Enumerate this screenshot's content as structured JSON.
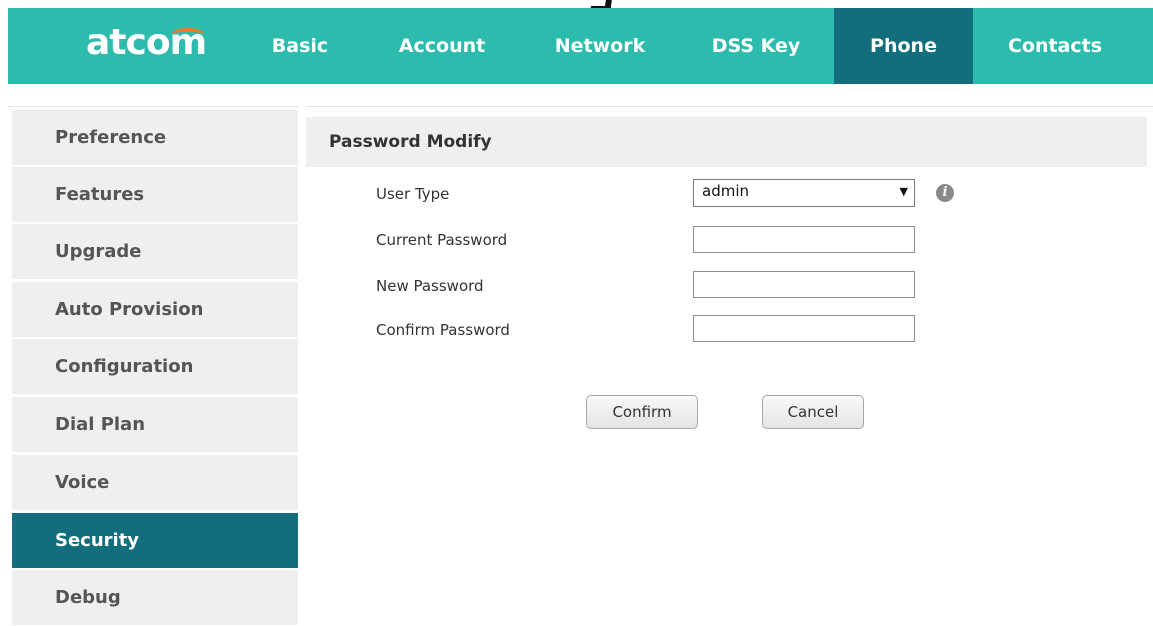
{
  "header": {
    "logo_text": "atcom",
    "brand_color": "#2dbbad",
    "active_color": "#126e7d",
    "accent_color": "#f07b1f",
    "tabs": [
      {
        "label": "Basic"
      },
      {
        "label": "Account"
      },
      {
        "label": "Network"
      },
      {
        "label": "DSS Key"
      },
      {
        "label": "Phone",
        "active": true
      },
      {
        "label": "Contacts"
      }
    ]
  },
  "sidebar": {
    "items": [
      {
        "label": "Preference"
      },
      {
        "label": "Features"
      },
      {
        "label": "Upgrade"
      },
      {
        "label": "Auto Provision"
      },
      {
        "label": "Configuration"
      },
      {
        "label": "Dial Plan"
      },
      {
        "label": "Voice"
      },
      {
        "label": "Security",
        "active": true
      },
      {
        "label": "Debug"
      }
    ]
  },
  "section": {
    "title": "Password Modify"
  },
  "form": {
    "user_type_label": "User Type",
    "user_type_value": "admin",
    "info_icon": "info-icon",
    "current_password_label": "Current Password",
    "current_password_value": "",
    "new_password_label": "New Password",
    "new_password_value": "",
    "confirm_password_label": "Confirm Password",
    "confirm_password_value": "",
    "confirm_button": "Confirm",
    "cancel_button": "Cancel"
  }
}
